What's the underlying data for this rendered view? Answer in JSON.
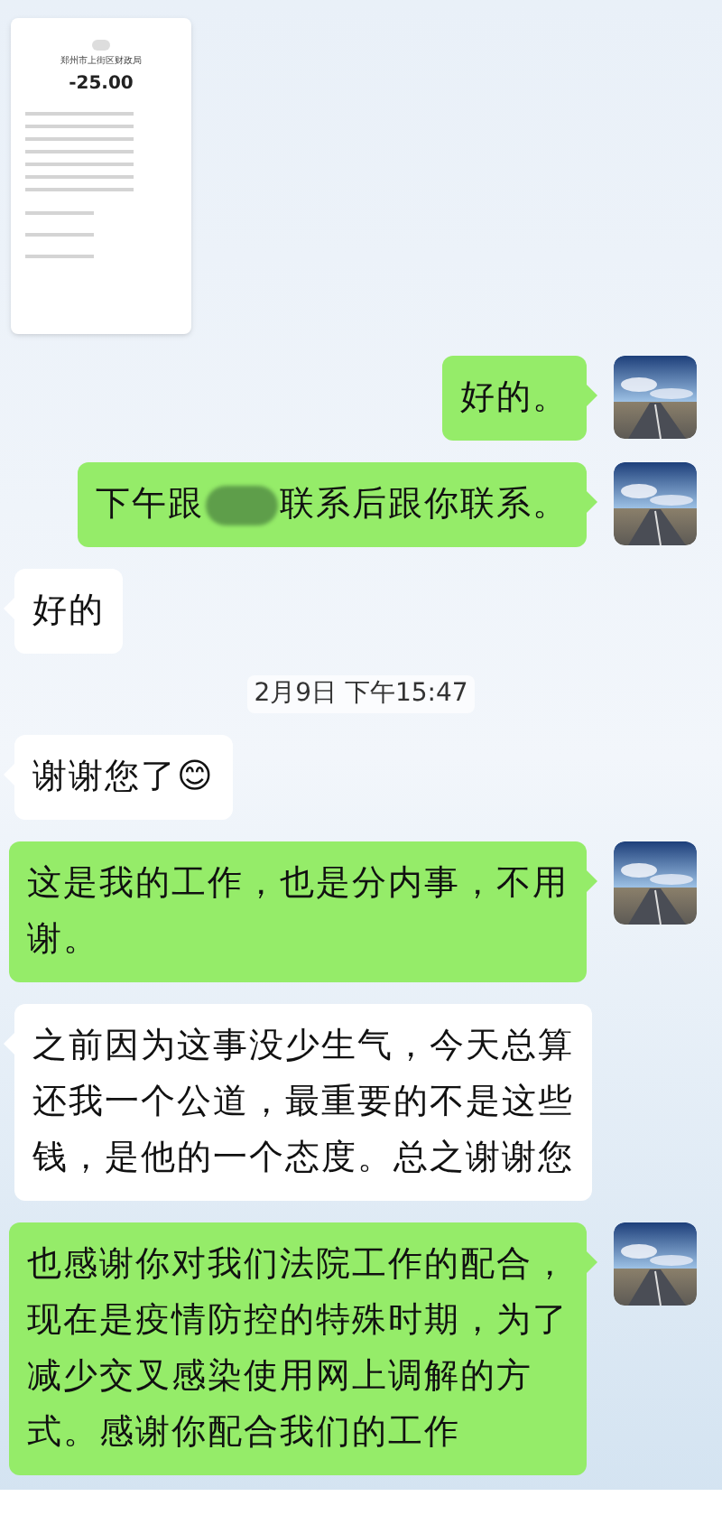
{
  "messages": [
    {
      "kind": "receipt",
      "payee": "郑州市上街区财政局",
      "amount": "-25.00"
    },
    {
      "kind": "text",
      "outgoing": true,
      "text": "好的。"
    },
    {
      "kind": "redacted",
      "outgoing": true,
      "before": "下午跟",
      "after": "联系后跟你联系。"
    },
    {
      "kind": "text",
      "outgoing": false,
      "text": "好的"
    },
    {
      "kind": "time",
      "text": "2月9日 下午15:47"
    },
    {
      "kind": "text",
      "outgoing": false,
      "text": "谢谢您了😊"
    },
    {
      "kind": "text",
      "outgoing": true,
      "text": "这是我的工作，也是分内事，不用谢。"
    },
    {
      "kind": "text",
      "outgoing": false,
      "text": "之前因为这事没少生气，今天总算还我一个公道，最重要的不是这些钱，是他的一个态度。总之谢谢您"
    },
    {
      "kind": "text",
      "outgoing": true,
      "text": "也感谢你对我们法院工作的配合，现在是疫情防控的特殊时期，为了减少交叉感染使用网上调解的方式。感谢你配合我们的工作"
    }
  ]
}
